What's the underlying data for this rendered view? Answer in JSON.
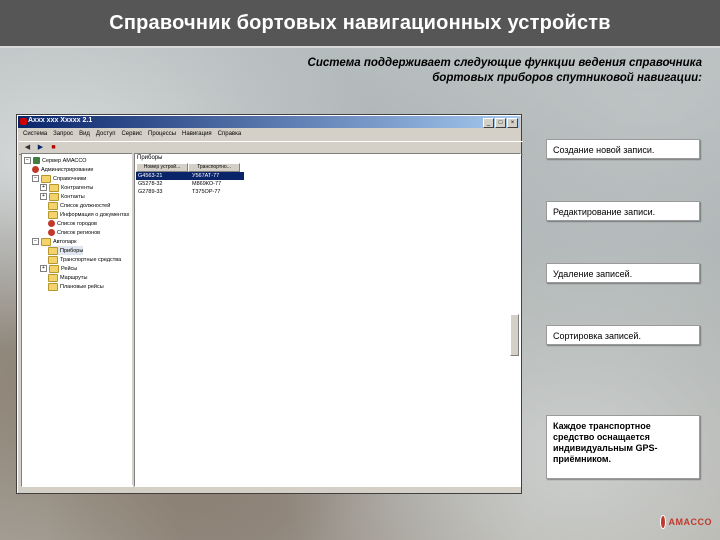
{
  "slide": {
    "title": "Справочник бортовых навигационных устройств",
    "intro": "Система поддерживает следующие функции ведения справочника бортовых приборов спутниковой навигации:"
  },
  "app": {
    "window_title": "Axxx xxx Xxxxx 2.1",
    "window_controls": [
      "_",
      "□",
      "×"
    ],
    "menu": [
      "Система",
      "Запрос",
      "Вид",
      "Доступ",
      "Сервис",
      "Процессы",
      "Навигация",
      "Справка"
    ],
    "tree": [
      {
        "label": "Сервер АМАССО"
      },
      {
        "label": "Администрирование"
      },
      {
        "label": "Справочники"
      },
      {
        "label": "Контрагенты"
      },
      {
        "label": "Контакты"
      },
      {
        "label": "Список должностей"
      },
      {
        "label": "Информация о документах"
      },
      {
        "label": "Список городов"
      },
      {
        "label": "Список регионов"
      },
      {
        "label": "Автопарк"
      },
      {
        "label": "Приборы"
      },
      {
        "label": "Транспортные средства"
      },
      {
        "label": "Рейсы"
      },
      {
        "label": "Маршруты"
      },
      {
        "label": "Плановые рейсы"
      }
    ],
    "pane_caption": "Приборы",
    "columns": [
      "Номер устрой...",
      "Транспортно..."
    ],
    "rows": [
      [
        "G4563-21",
        "У567АТ-77"
      ],
      [
        "G5278-32",
        "М869КО-77"
      ],
      [
        "G2789-33",
        "Т375ОР-77"
      ]
    ]
  },
  "features": [
    "Создание новой записи.",
    "Редактирование записи.",
    "Удаление записей.",
    "Сортировка записей."
  ],
  "note": "Каждое транспортное средство оснащается индивидуальным GPS-приёмником.",
  "logo": {
    "text": "AMACCO"
  }
}
